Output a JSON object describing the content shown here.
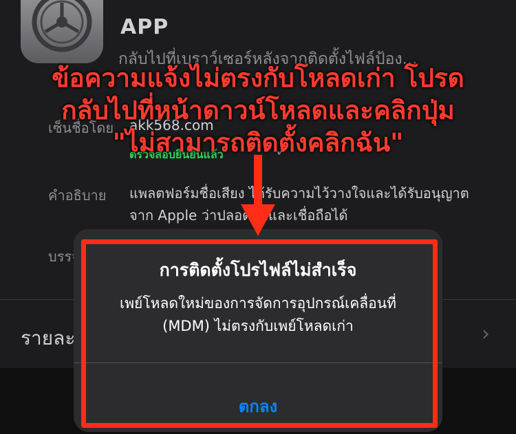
{
  "app": {
    "title": "APP",
    "subtitle": "กลับไปที่เบราว์เซอร์หลังจากติดตั้งไฟล์ป้อง..."
  },
  "profile": {
    "signed_by_label": "เซ็นชื่อโดย",
    "signed_by_value": "akk568.com",
    "verified_text": "ตรวจสอบยืนยันแล้ว",
    "description_label": "คำอธิบาย",
    "description_text": "แพลตฟอร์มชื่อเสียง ได้รับความไว้วางใจและได้รับอนุญาตจาก Apple ว่าปลอดภัยและเชื่อถือได้",
    "contains_label": "บรรจุ",
    "details_label": "รายละเอียดเพิ่มเติม"
  },
  "annotation": {
    "line1": "ข้อความแจ้งไม่ตรงกับโหลดเก่า โปรด",
    "line2": "กลับไปที่หน้าดาวน์โหลดและคลิกปุ่ม",
    "line3": "\"ไม่สามารถติดตั้งคลิกฉัน\"",
    "color": "#ff3b30"
  },
  "alert": {
    "title": "การติดตั้งโปรไฟล์ไม่สำเร็จ",
    "message": "เพย์โหลดใหม่ของการจัดการอุปกรณ์เคลื่อนที่ (MDM) ไม่ตรงกับเพย์โหลดเก่า",
    "button_label": "ตกลง",
    "button_color": "#0a84ff"
  },
  "icons": {
    "app_icon": "settings-gear-icon",
    "chevron": "chevron-right-icon",
    "check": "checkmark-icon"
  }
}
